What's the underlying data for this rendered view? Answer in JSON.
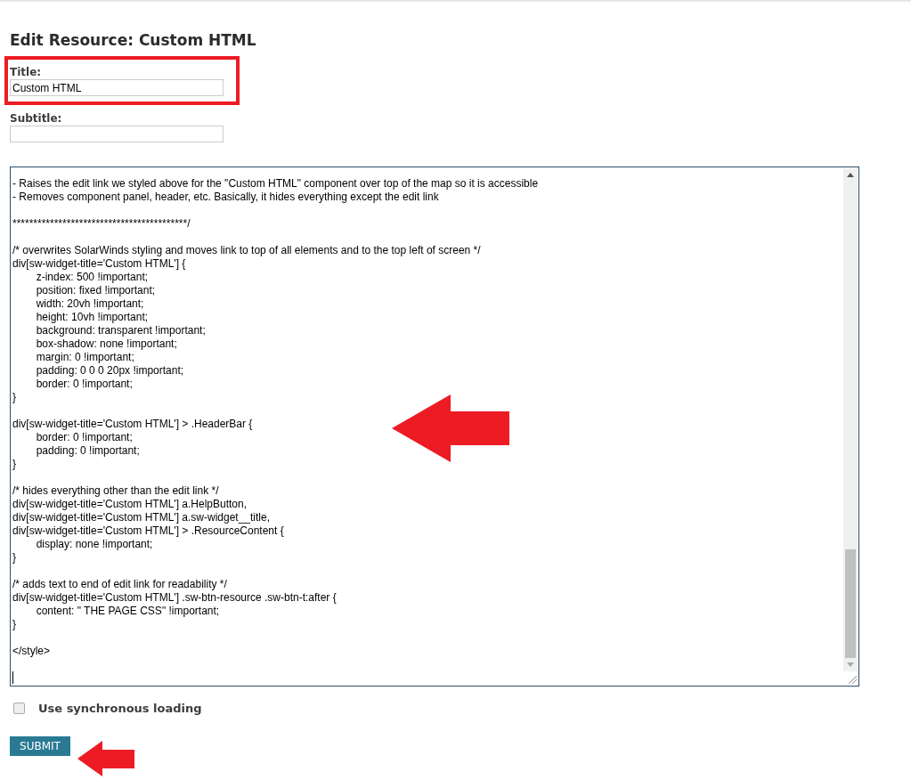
{
  "heading": "Edit Resource: Custom HTML",
  "title_field": {
    "label": "Title:",
    "value": "Custom HTML",
    "highlighted": true
  },
  "subtitle_field": {
    "label": "Subtitle:"
  },
  "code_blocks": [
    [
      "- Raises the edit link we styled above for the \"Custom HTML\" component over top of the map so it is accessible",
      "- Removes component panel, header, etc. Basically, it hides everything except the edit link"
    ],
    [
      "******************************************/"
    ],
    [
      "/* overwrites SolarWinds styling and moves link to top of all elements and to the top left of screen */",
      "div[sw-widget-title='Custom HTML'] {",
      "\tz-index: 500 !important;",
      "\tposition: fixed !important;",
      "\twidth: 20vh !important;",
      "\theight: 10vh !important;",
      "\tbackground: transparent !important;",
      "\tbox-shadow: none !important;",
      "\tmargin: 0 !important;",
      "\tpadding: 0 0 0 20px !important;",
      "\tborder: 0 !important;",
      "}"
    ],
    [
      "div[sw-widget-title='Custom HTML'] > .HeaderBar {",
      "\tborder: 0 !important;",
      "\tpadding: 0 !important;",
      "}"
    ],
    [
      "/* hides everything other than the edit link */",
      "div[sw-widget-title='Custom HTML'] a.HelpButton,",
      "div[sw-widget-title='Custom HTML'] a.sw-widget__title,",
      "div[sw-widget-title='Custom HTML'] > .ResourceContent {",
      "\tdisplay: none !important;",
      "}"
    ],
    [
      "/* adds text to end of edit link for readability */",
      "div[sw-widget-title='Custom HTML'] .sw-btn-resource .sw-btn-t:after {",
      "\tcontent: \" THE PAGE CSS\" !important;",
      "}"
    ],
    [
      "</style>"
    ]
  ],
  "sync_loading": {
    "label": "Use synchronous loading",
    "checked": false
  },
  "submit": {
    "label": "SUBMIT"
  }
}
